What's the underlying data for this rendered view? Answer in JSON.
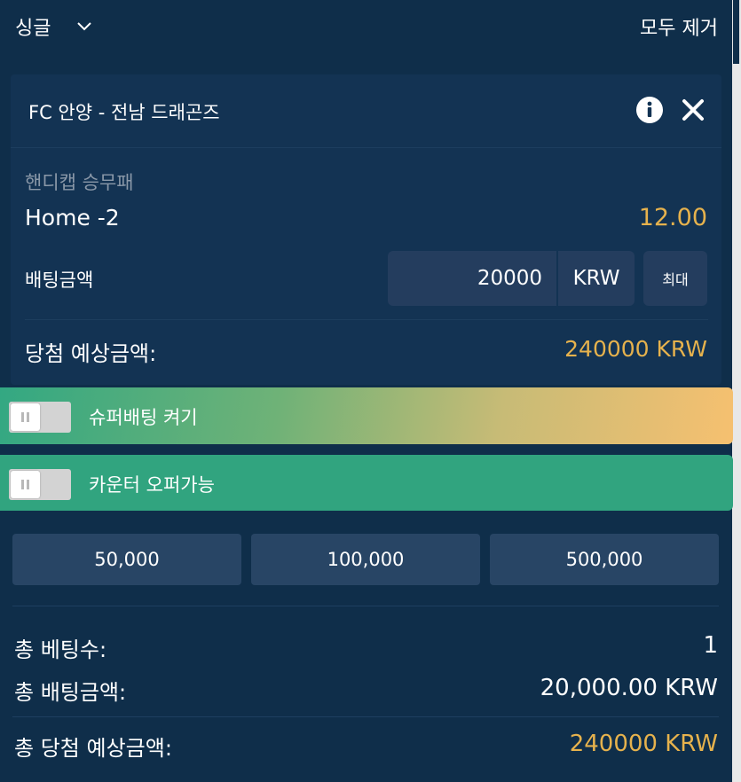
{
  "header": {
    "mode_label": "싱글",
    "remove_all_label": "모두 제거"
  },
  "bet": {
    "match_title": "FC 안양 - 전남 드래곤즈",
    "market": "핸디캡 승무패",
    "selection": "Home -2",
    "odds": "12.00",
    "stake_label": "배팅금액",
    "stake_value": "20000",
    "currency": "KRW",
    "max_label": "최대",
    "potential_win_label": "당첨 예상금액:",
    "potential_win_value": "240000 KRW"
  },
  "toggles": {
    "superbet_label": "슈퍼배팅 켜기",
    "superbet_on": false,
    "counter_offer_label": "카운터 오퍼가능",
    "counter_offer_on": false
  },
  "quick_amounts": [
    "50,000",
    "100,000",
    "500,000"
  ],
  "summary": {
    "total_bets_label": "총 베팅수:",
    "total_bets_value": "1",
    "total_stake_label": "총 배팅금액:",
    "total_stake_value": "20,000.00 KRW",
    "total_potential_label": "총 당첨 예상금액:",
    "total_potential_value": "240000 KRW"
  },
  "colors": {
    "background": "#0f2e4a",
    "card": "#133353",
    "input": "#243d5e",
    "accent_gold": "#e6b24d",
    "green": "#31a47f",
    "orange": "#f6c070"
  },
  "icons": {
    "dropdown": "chevron-down-icon",
    "info": "info-icon",
    "close": "close-icon",
    "toggle_knob": "pause-icon"
  }
}
